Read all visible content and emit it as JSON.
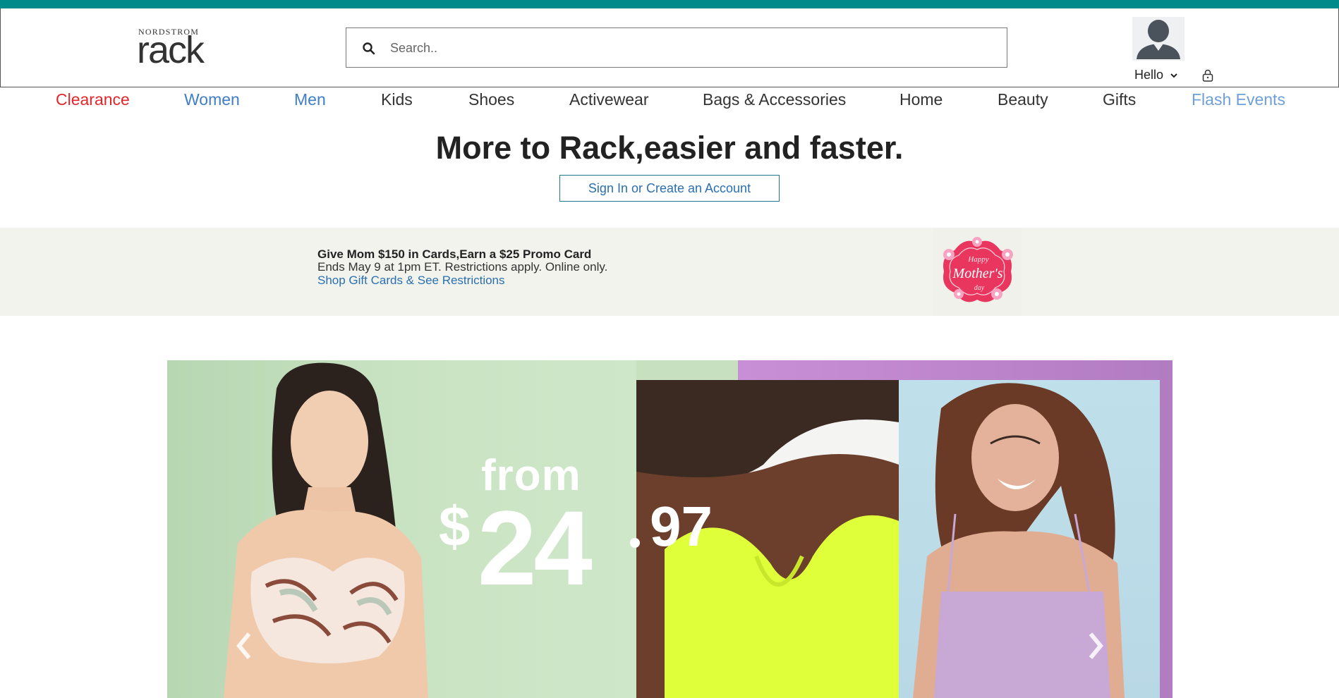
{
  "header": {
    "logo": {
      "brand": "NORDSTROM",
      "wordmark": "rack"
    },
    "search": {
      "placeholder": "Search..",
      "icon": "search-icon"
    },
    "account": {
      "greeting": "Hello",
      "avatar_icon": "user-avatar-icon",
      "chevron_icon": "chevron-down-icon",
      "lock_icon": "lock-icon"
    }
  },
  "nav": {
    "items": [
      {
        "label": "Clearance",
        "color": "#e3262e"
      },
      {
        "label": "Women",
        "color": "#3f7ec6"
      },
      {
        "label": "Men",
        "color": "#3f7ec6"
      },
      {
        "label": "Kids",
        "color": "#333333"
      },
      {
        "label": "Shoes",
        "color": "#333333"
      },
      {
        "label": "Activewear",
        "color": "#333333"
      },
      {
        "label": "Bags & Accessories",
        "color": "#333333"
      },
      {
        "label": "Home",
        "color": "#333333"
      },
      {
        "label": "Beauty",
        "color": "#333333"
      },
      {
        "label": "Gifts",
        "color": "#333333"
      },
      {
        "label": "Flash Events",
        "color": "#6f9fd8"
      }
    ]
  },
  "promo": {
    "title": "More to Rack,easier and faster.",
    "signin_label": "Sign In or Create an Account"
  },
  "banner": {
    "headline": "Give Mom $150 in Cards,Earn a $25 Promo Card",
    "subline": "Ends May 9 at 1pm ET. Restrictions apply. Online only.",
    "link": "Shop Gift Cards & See Restrictions",
    "badge": {
      "happy": "Happy",
      "mothers": "Mother's",
      "day": "day"
    }
  },
  "hero": {
    "from": "from",
    "dollar": "$",
    "whole": "24",
    "cents": "97",
    "prev_icon": "chevron-left-icon",
    "next_icon": "chevron-right-icon"
  },
  "colors": {
    "topbar": "#008a8a",
    "link_blue": "#2a6fb0",
    "clearance_red": "#e3262e"
  }
}
